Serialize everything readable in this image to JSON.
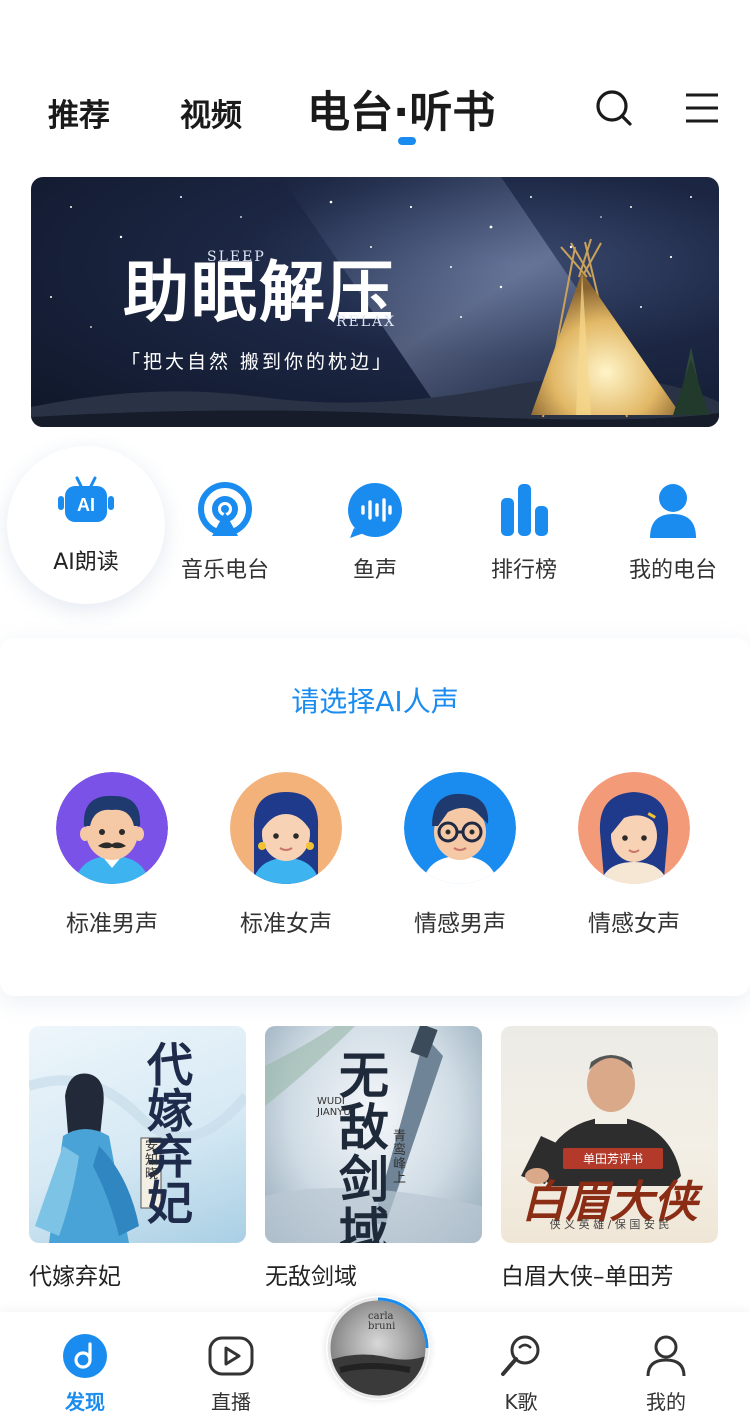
{
  "nav": {
    "tabs": [
      {
        "label": "推荐"
      },
      {
        "label": "视频"
      },
      {
        "label": "电台·听书"
      }
    ],
    "icons": {
      "search": "search-icon",
      "menu": "menu-icon"
    }
  },
  "banner": {
    "title": "助眠解压",
    "sleep": "SLEEP",
    "relax": "RELAX",
    "subtitle": "「把大自然 搬到你的枕边」"
  },
  "quick_nav": [
    {
      "label": "AI朗读",
      "icon": "ai-robot-icon"
    },
    {
      "label": "音乐电台",
      "icon": "radio-icon"
    },
    {
      "label": "鱼声",
      "icon": "voice-bubble-icon"
    },
    {
      "label": "排行榜",
      "icon": "bar-chart-icon"
    },
    {
      "label": "我的电台",
      "icon": "user-icon"
    }
  ],
  "voice_select": {
    "title": "请选择AI人声",
    "voices": [
      {
        "label": "标准男声"
      },
      {
        "label": "标准女声"
      },
      {
        "label": "情感男声"
      },
      {
        "label": "情感女声"
      }
    ]
  },
  "books": [
    {
      "title": "代嫁弃妃",
      "cover_text": "代嫁弃妃",
      "author": "安知晓"
    },
    {
      "title": "无敌剑域",
      "cover_text": "无敌剑域",
      "author": "青鸾峰上",
      "roman": "WUDI JIANYU"
    },
    {
      "title": "白眉大侠–单田芳",
      "cover_text": "白眉大侠",
      "badge": "单田芳评书",
      "tagline": "侠 义 英 雄 / 保 国 安 民"
    }
  ],
  "bottom_nav": [
    {
      "label": "发现",
      "icon": "discover-icon",
      "active": true
    },
    {
      "label": "直播",
      "icon": "live-play-icon"
    },
    {
      "label": "K歌",
      "icon": "microphone-icon"
    },
    {
      "label": "我的",
      "icon": "profile-icon"
    }
  ],
  "player": {
    "text": "carla bruni"
  },
  "colors": {
    "accent": "#1a8cf0"
  }
}
